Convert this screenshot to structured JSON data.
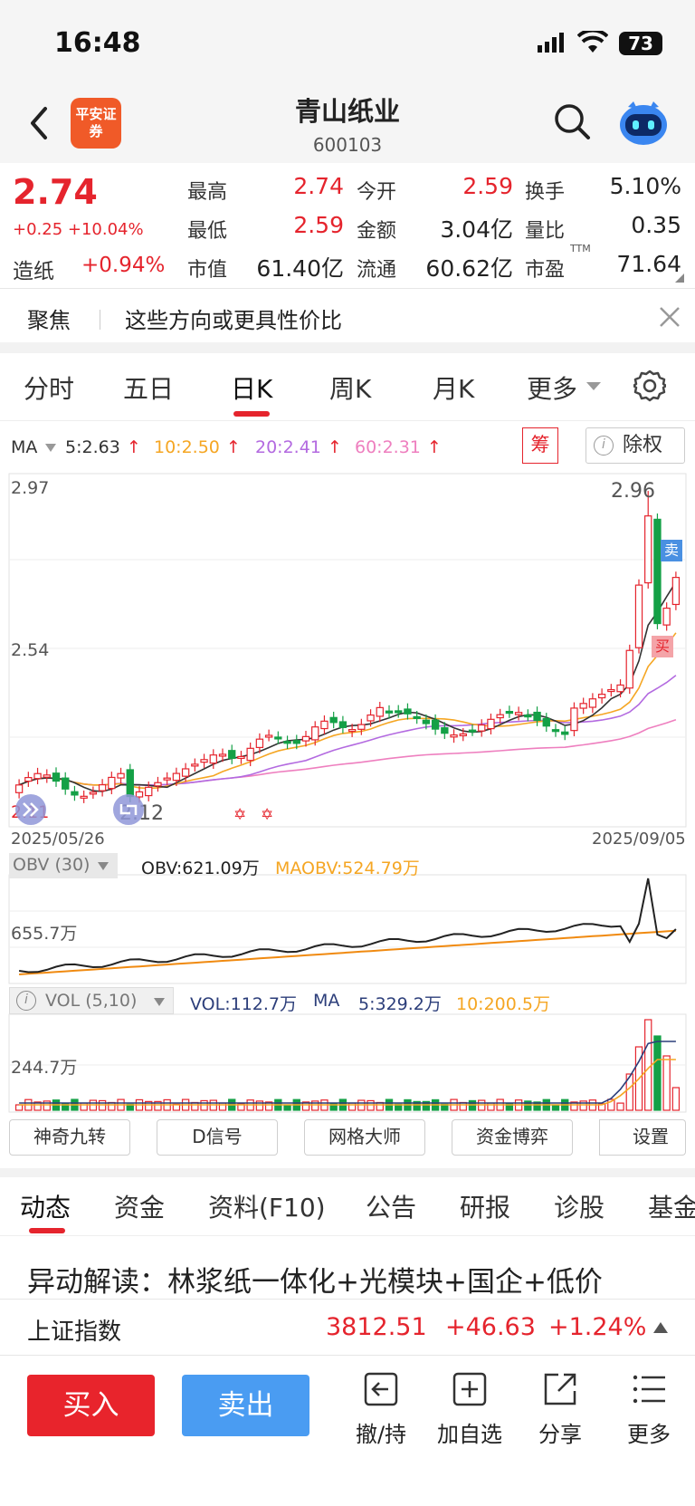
{
  "status_bar": {
    "time": "16:48",
    "battery": "73"
  },
  "header": {
    "logo_text": "平安证券",
    "stock_name": "青山纸业",
    "stock_code": "600103"
  },
  "quote": {
    "price": "2.74",
    "change": "+0.25 +10.04%",
    "sector_name": "造纸",
    "sector_change": "+0.94%",
    "fields": {
      "high_label": "最高",
      "high": "2.74",
      "open_label": "今开",
      "open": "2.59",
      "turnover_label": "换手",
      "turnover": "5.10%",
      "low_label": "最低",
      "low": "2.59",
      "amount_label": "金额",
      "amount": "3.04亿",
      "vol_ratio_label": "量比",
      "vol_ratio": "0.35",
      "mktcap_label": "市值",
      "mktcap": "61.40亿",
      "float_label": "流通",
      "float": "60.62亿",
      "pe_label": "市盈",
      "pe_sup": "TTM",
      "pe": "71.64"
    }
  },
  "focus": {
    "label": "聚焦",
    "text": "这些方向或更具性价比"
  },
  "period_tabs": [
    "分时",
    "五日",
    "日K",
    "周K",
    "月K",
    "更多"
  ],
  "active_period": "日K",
  "ma_legend": {
    "name": "MA",
    "ma5": "5:2.63",
    "ma10": "10:2.50",
    "ma20": "20:2.41",
    "ma60": "60:2.31",
    "chou": "筹",
    "chuquan": "除权"
  },
  "kline": {
    "y_top": "2.97",
    "y_mid": "2.54",
    "y_bottom": "2.11",
    "max_marker": "2.96",
    "min_marker": "2.12",
    "date_start": "2025/05/26",
    "date_end": "2025/09/05",
    "sell_marker": "卖",
    "buy_marker": "买"
  },
  "obv": {
    "name": "OBV (30)",
    "value": "OBV:621.09万",
    "ma_value": "MAOBV:524.79万",
    "axis_label": "655.7万"
  },
  "vol": {
    "name": "VOL (5,10)",
    "value": "VOL:112.7万",
    "ma_label": "MA",
    "ma5": "5:329.2万",
    "ma10": "10:200.5万",
    "axis_label": "244.7万"
  },
  "indicator_buttons": [
    "神奇九转",
    "D信号",
    "网格大师",
    "资金博弈",
    "设置"
  ],
  "info_tabs": [
    "动态",
    "资金",
    "资料(F10)",
    "公告",
    "研报",
    "诊股",
    "基金"
  ],
  "news_title": "异动解读：林浆纸一体化+光模块+国企+低价",
  "index_bar": {
    "name": "上证指数",
    "value": "3812.51",
    "change": "+46.63",
    "pct": "+1.24%"
  },
  "actions": {
    "buy": "买入",
    "sell": "卖出",
    "withdraw": "撤/持",
    "add_watch": "加自选",
    "share": "分享",
    "more": "更多"
  },
  "colors": {
    "up": "#e5242d",
    "down": "#14a046",
    "ma5": "#333333",
    "ma10": "#f5a623",
    "ma20": "#b36ae0",
    "ma60": "#ee7fbf",
    "sell_btn": "#4a9cf2"
  }
}
